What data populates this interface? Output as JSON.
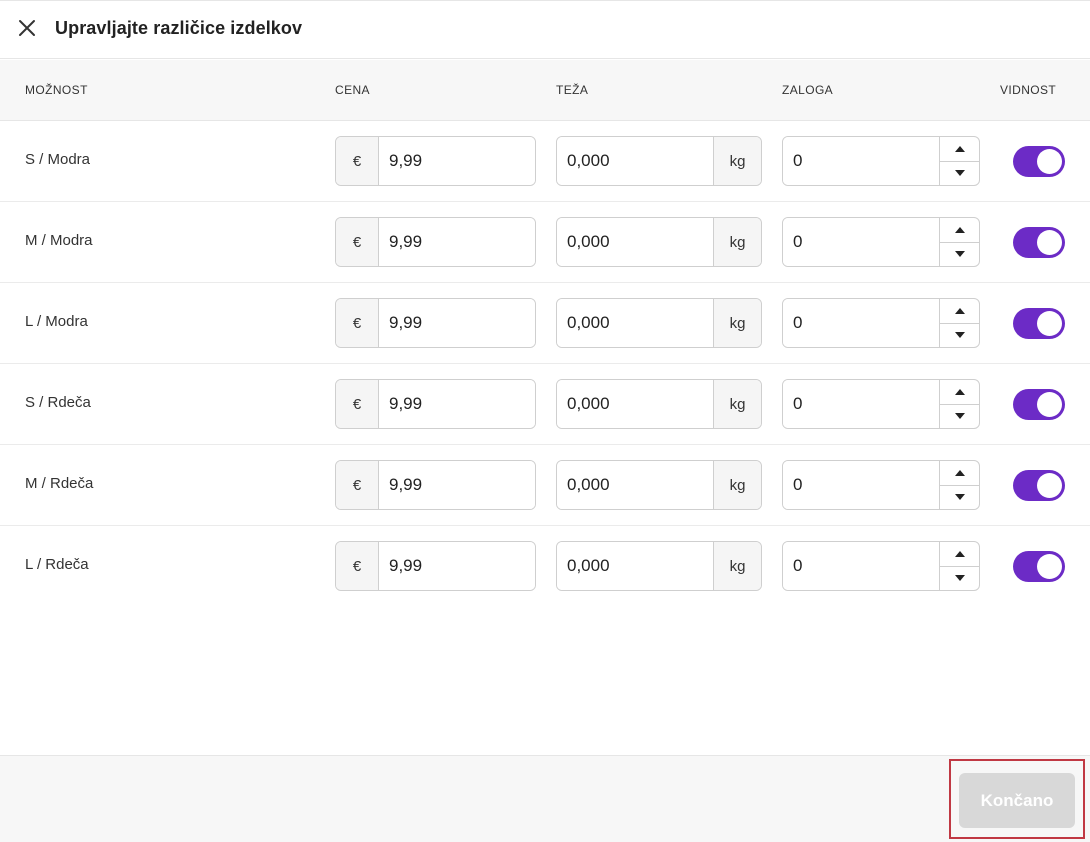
{
  "dialog": {
    "title": "Upravljajte različice izdelkov",
    "close_icon": "close-icon"
  },
  "columns": {
    "option": "MOŽNOST",
    "price": "CENA",
    "weight": "TEŽA",
    "stock": "ZALOGA",
    "visibility": "VIDNOST"
  },
  "currency_symbol": "€",
  "weight_unit": "kg",
  "accent_color": "#6c2bc6",
  "variants": [
    {
      "label": "S / Modra",
      "price": "9,99",
      "weight": "0,000",
      "stock": "0",
      "visible": true
    },
    {
      "label": "M / Modra",
      "price": "9,99",
      "weight": "0,000",
      "stock": "0",
      "visible": true
    },
    {
      "label": "L / Modra",
      "price": "9,99",
      "weight": "0,000",
      "stock": "0",
      "visible": true
    },
    {
      "label": "S / Rdeča",
      "price": "9,99",
      "weight": "0,000",
      "stock": "0",
      "visible": true
    },
    {
      "label": "M / Rdeča",
      "price": "9,99",
      "weight": "0,000",
      "stock": "0",
      "visible": true
    },
    {
      "label": "L / Rdeča",
      "price": "9,99",
      "weight": "0,000",
      "stock": "0",
      "visible": true
    }
  ],
  "footer": {
    "done_label": "Končano"
  }
}
